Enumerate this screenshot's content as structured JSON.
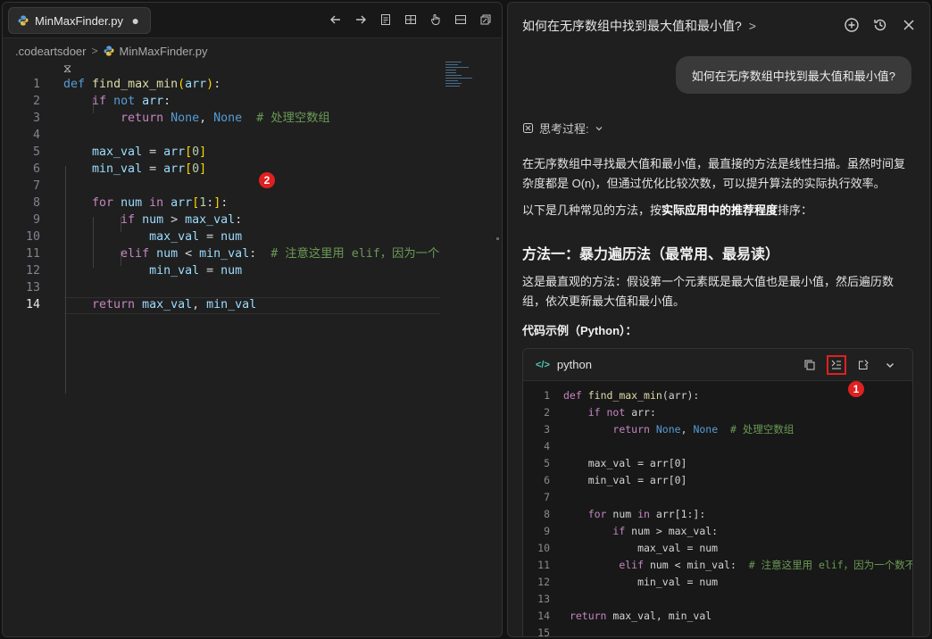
{
  "editor": {
    "tab": {
      "name": "MinMaxFinder.py",
      "dirty_marker": "●"
    },
    "breadcrumb": [
      ".codeartsdoer",
      "MinMaxFinder.py"
    ],
    "toolbar_icons": [
      "arrow-left-icon",
      "arrow-right-icon",
      "document-icon",
      "split-grid-icon",
      "hand-pointer-icon",
      "panel-icon",
      "restore-icon"
    ],
    "overlay_badge": "2",
    "lines": [
      {
        "n": "1",
        "html": "<span class=\"kw\">def</span> <span class=\"fn\">find_max_min</span><span class=\"br\">(</span><span class=\"var\">arr</span><span class=\"br\">)</span>:"
      },
      {
        "n": "2",
        "html": "    <span class=\"ctl\">if</span> <span class=\"kw\">not</span> <span class=\"var\">arr</span>:"
      },
      {
        "n": "3",
        "html": "        <span class=\"ctl\">return</span> <span class=\"kw\">None</span>, <span class=\"kw\">None</span>  <span class=\"cm\"># 处理空数组</span>"
      },
      {
        "n": "4",
        "html": ""
      },
      {
        "n": "5",
        "html": "    <span class=\"var\">max_val</span> = <span class=\"var\">arr</span><span class=\"br\">[</span><span class=\"num\">0</span><span class=\"br\">]</span>"
      },
      {
        "n": "6",
        "html": "    <span class=\"var\">min_val</span> = <span class=\"var\">arr</span><span class=\"br\">[</span><span class=\"num\">0</span><span class=\"br\">]</span>"
      },
      {
        "n": "7",
        "html": ""
      },
      {
        "n": "8",
        "html": "    <span class=\"ctl\">for</span> <span class=\"var\">num</span> <span class=\"ctl\">in</span> <span class=\"var\">arr</span><span class=\"br\">[</span><span class=\"num\">1</span>:<span class=\"br\">]</span>:"
      },
      {
        "n": "9",
        "html": "        <span class=\"ctl\">if</span> <span class=\"var\">num</span> &gt; <span class=\"var\">max_val</span>:"
      },
      {
        "n": "10",
        "html": "            <span class=\"var\">max_val</span> = <span class=\"var\">num</span>"
      },
      {
        "n": "11",
        "html": "        <span class=\"ctl\">elif</span> <span class=\"var\">num</span> &lt; <span class=\"var\">min_val</span>:  <span class=\"cm\"># 注意这里用 elif，因为一个数</span>"
      },
      {
        "n": "12",
        "html": "            <span class=\"var\">min_val</span> = <span class=\"var\">num</span>"
      },
      {
        "n": "13",
        "html": ""
      },
      {
        "n": "14",
        "html": "    <span class=\"ctl\">return</span> <span class=\"var\">max_val</span>, <span class=\"var\">min_val</span>"
      }
    ]
  },
  "chat": {
    "title": "如何在无序数组中找到最大值和最小值?",
    "title_chevron": ">",
    "header_icons": [
      "new-chat-icon",
      "history-icon",
      "close-icon"
    ],
    "user_message": "如何在无序数组中找到最大值和最小值?",
    "thinking_label": "思考过程:",
    "para1": "在无序数组中寻找最大值和最小值，最直接的方法是线性扫描。虽然时间复杂度都是 O(n)，但通过优化比较次数，可以提升算法的实际执行效率。",
    "para2_pre": "以下是几种常见的方法，按",
    "para2_bold": "实际应用中的推荐程度",
    "para2_post": "排序：",
    "method_heading": "方法一：暴力遍历法（最常用、最易读）",
    "para3": "这是最直观的方法：假设第一个元素既是最大值也是最小值，然后遍历数组，依次更新最大值和最小值。",
    "code_heading": "代码示例（Python）：",
    "codeblock": {
      "lang_icon": "</>",
      "lang": "python",
      "badge": "1",
      "action_icons": [
        "copy-icon",
        "insert-code-icon",
        "apply-icon",
        "collapse-chevron-icon"
      ],
      "lines": [
        {
          "n": "1",
          "html": "<span class=\"ctl\">def</span> <span class=\"fn\">find_max_min</span>(arr):"
        },
        {
          "n": "2",
          "html": "    <span class=\"ctl\">if</span> <span class=\"ctl\">not</span> arr:"
        },
        {
          "n": "3",
          "html": "        <span class=\"ctl\">return</span> <span class=\"kw\">None</span>, <span class=\"kw\">None</span>  <span class=\"cm\"># 处理空数组</span>"
        },
        {
          "n": "4",
          "html": ""
        },
        {
          "n": "5",
          "html": "    max_val = arr[0]"
        },
        {
          "n": "6",
          "html": "    min_val = arr[0]"
        },
        {
          "n": "7",
          "html": ""
        },
        {
          "n": "8",
          "html": "    <span class=\"ctl\">for</span> num <span class=\"ctl\">in</span> arr[1:]:"
        },
        {
          "n": "9",
          "html": "        <span class=\"ctl\">if</span> num &gt; max_val:"
        },
        {
          "n": "10",
          "html": "            max_val = num"
        },
        {
          "n": "11",
          "html": "         <span class=\"ctl\">elif</span> num &lt; min_val:  <span class=\"cm\"># 注意这里用 elif，因为一个数不可</span>"
        },
        {
          "n": "12",
          "html": "            min_val = num"
        },
        {
          "n": "13",
          "html": ""
        },
        {
          "n": "14",
          "html": " <span class=\"ctl\">return</span> max_val, min_val"
        },
        {
          "n": "15",
          "html": ""
        }
      ]
    }
  }
}
